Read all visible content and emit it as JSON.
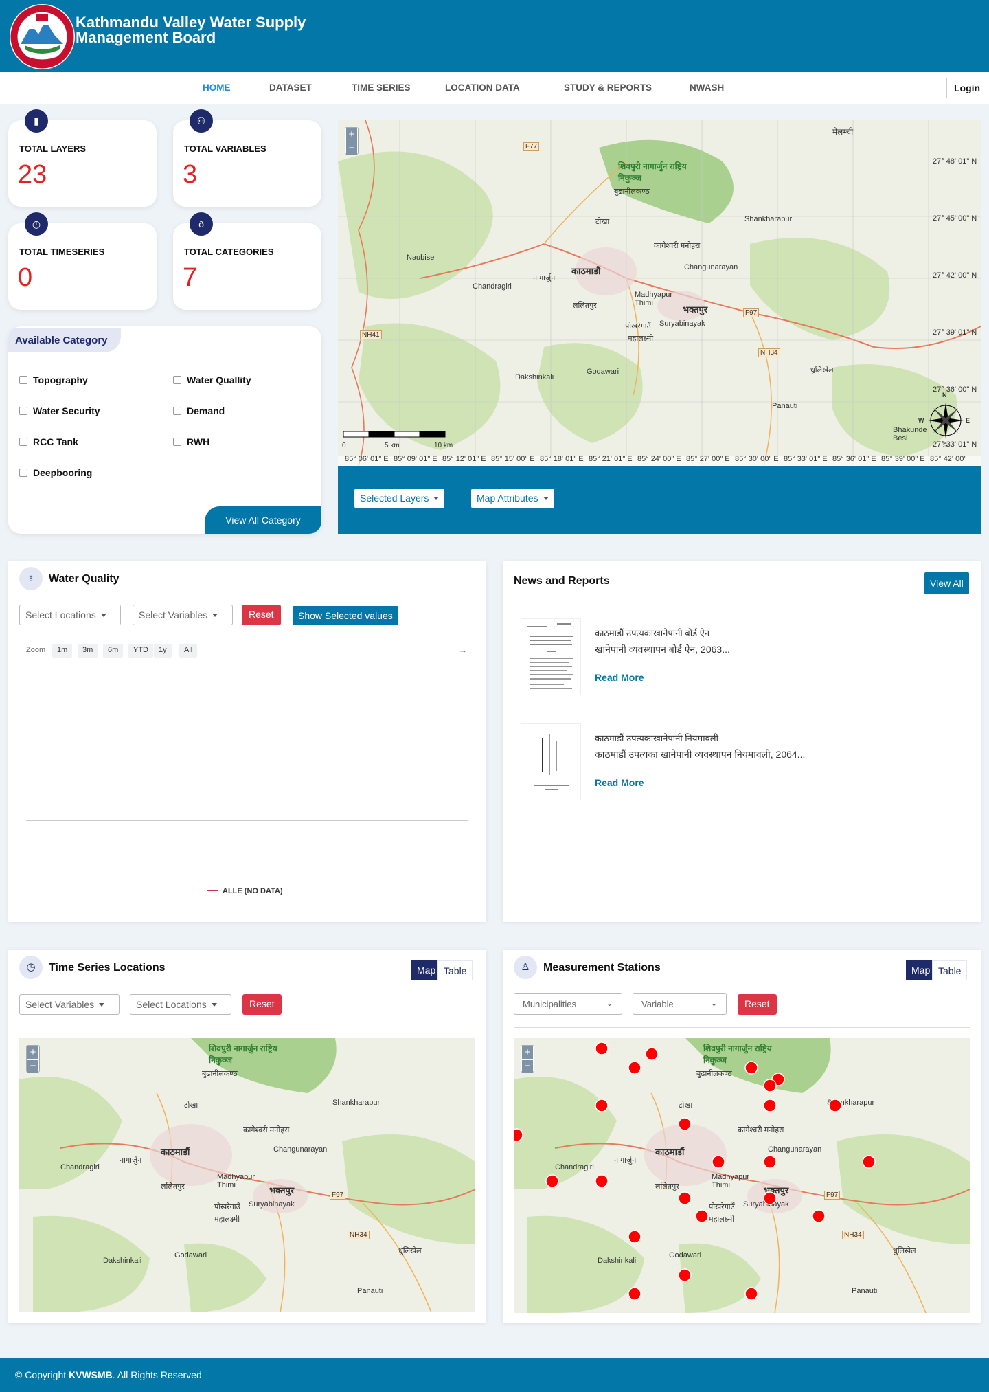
{
  "site": {
    "title": "Kathmandu Valley Water Supply Management Board"
  },
  "nav": {
    "items": [
      "HOME",
      "DATASET",
      "TIME SERIES",
      "LOCATION DATA",
      "STUDY & REPORTS",
      "NWASH"
    ],
    "login": "Login"
  },
  "stats": [
    {
      "label": "TOTAL LAYERS",
      "value": "23",
      "icon": "layers-icon"
    },
    {
      "label": "TOTAL VARIABLES",
      "value": "3",
      "icon": "variables-icon"
    },
    {
      "label": "TOTAL TIMESERIES",
      "value": "0",
      "icon": "clock-icon"
    },
    {
      "label": "TOTAL CATEGORIES",
      "value": "7",
      "icon": "categories-icon"
    }
  ],
  "categories": {
    "title": "Available Category",
    "items": [
      "Topography",
      "Water Quallity",
      "Water Security",
      "Demand",
      "RCC Tank",
      "RWH",
      "Deepbooring"
    ],
    "view_all": "View All Category"
  },
  "main_map": {
    "labels": {
      "melamchi": "मेलम्ची",
      "shivapuri": "शिवपुरी नागार्जुन राष्ट्रिय निकुञ्ज",
      "budhanilkantha": "बुढानीलकण्ठ",
      "tokha": "टोखा",
      "shankharapur": "Shankharapur",
      "naubise": "Naubise",
      "kathmandu": "काठमाडौं",
      "kageshwori": "कागेश्वरी मनोहरा",
      "changunarayan": "Changunarayan",
      "chandragiri": "Chandragiri",
      "nagarjun": "नागार्जुन",
      "madhyapur": "Madhyapur Thimi",
      "lalitpur": "ललितपुर",
      "bhaktapur": "भक्तपुर",
      "suryabinayak": "Suryabinayak",
      "pokhari": "पोखरेगाउँ",
      "mahalaxmi": "महालक्ष्मी",
      "dakshinkali": "Dakshinkali",
      "godawari": "Godawari",
      "dhulikhel": "धुलिखेल",
      "panauti": "Panauti",
      "bhakundebesi": "Bhakunde Besi",
      "f77": "F77",
      "nh41": "NH41",
      "f97": "F97",
      "nh34": "NH34"
    },
    "lat_ticks": [
      "27° 48' 01\" N",
      "27° 45' 00\" N",
      "27° 42' 00\" N",
      "27° 39' 01\" N",
      "27° 36' 00\" N",
      "27° 33' 01\" N"
    ],
    "lon_ticks": [
      "85° 06' 01\" E",
      "85° 09' 01\" E",
      "85° 12' 01\" E",
      "85° 15' 00\" E",
      "85° 18' 01\" E",
      "85° 21' 01\" E",
      "85° 24' 00\" E",
      "85° 27' 00\" E",
      "85° 30' 00\" E",
      "85° 33' 01\" E",
      "85° 36' 01\" E",
      "85° 39' 00\" E",
      "85° 42' 00\""
    ],
    "scale": [
      "0",
      "5 km",
      "10 km"
    ],
    "compass": {
      "n": "N",
      "s": "S",
      "e": "E",
      "w": "W"
    },
    "selected_layers": "Selected Layers",
    "map_attributes": "Map Attributes"
  },
  "water_quality": {
    "title": "Water Quality",
    "select_locations": "Select Locations",
    "select_variables": "Select Variables",
    "reset": "Reset",
    "show_selected": "Show Selected values",
    "zoom_label": "Zoom",
    "zoom_options": [
      "1m",
      "3m",
      "6m",
      "YTD",
      "1y",
      "All"
    ],
    "arrow": "→",
    "legend": "ALLE (NO DATA)"
  },
  "news": {
    "title": "News and Reports",
    "view_all": "View All",
    "items": [
      {
        "kicker": "काठमाडौं उपत्यकाखानेपानी बोर्ड ऐन",
        "title": "खानेपानी व्यवस्थापन बोर्ड ऐन, 2063...",
        "read_more": "Read More"
      },
      {
        "kicker": "काठमाडौं उपत्यकाखानेपानी नियमावली",
        "title": "काठमाडौं उपत्यका खानेपानी व्यवस्थापन नियमावली, 2064...",
        "read_more": "Read More"
      }
    ]
  },
  "time_series": {
    "title": "Time Series Locations",
    "map": "Map",
    "table": "Table",
    "select_variables": "Select Variables",
    "select_locations": "Select Locations",
    "reset": "Reset"
  },
  "stations": {
    "title": "Measurement Stations",
    "map": "Map",
    "table": "Table",
    "municipalities": "Municipalities",
    "variable": "Variable",
    "reset": "Reset"
  },
  "footer": {
    "prefix": "© Copyright ",
    "brand": "KVWSMB",
    "suffix": ". All Rights Reserved"
  }
}
